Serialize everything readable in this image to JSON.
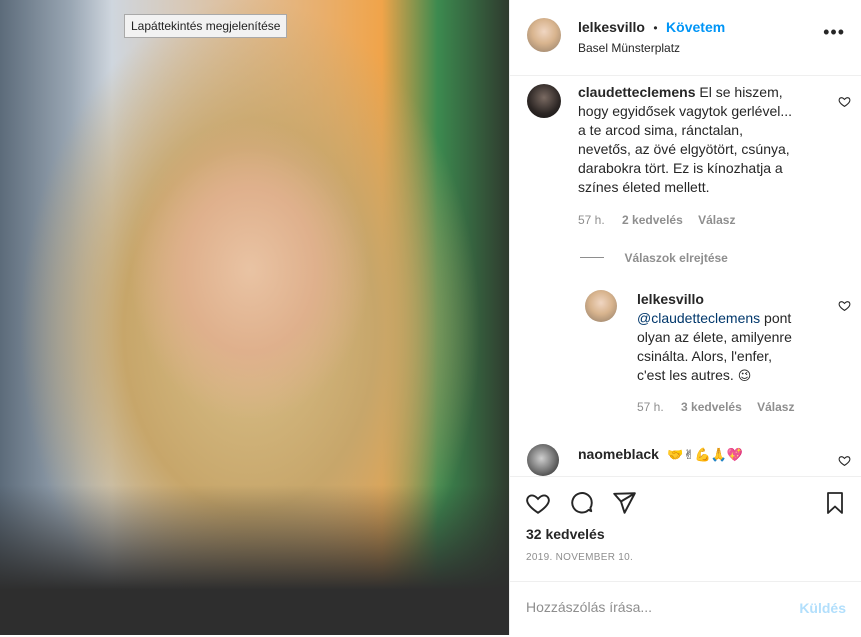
{
  "photo": {
    "tooltip": "Lapáttekintés megjelenítése"
  },
  "header": {
    "username": "lelkesvillo",
    "separator": "•",
    "follow_label": "Követem",
    "location": "Basel Münsterplatz",
    "more": "•••"
  },
  "comments": [
    {
      "username": "claudetteclemens",
      "lines": [
        "El se hiszem,",
        "hogy egyidősek vagytok gerlével...",
        "a te arcod sima, ránctalan,",
        "nevetős, az övé elgyötört, csúnya,",
        "darabokra tört. Ez is kínozhatja a",
        "színes életed mellett."
      ],
      "time": "57 h.",
      "likes": "2 kedvelés",
      "reply": "Válasz"
    }
  ],
  "hide_replies": "Válaszok elrejtése",
  "reply": {
    "username": "lelkesvillo",
    "mention": "@claudetteclemens",
    "line1_rest": " pont",
    "lines": [
      "olyan az élete, amilyenre",
      "csinálta. Alors, l'enfer,"
    ],
    "last_line": "c'est les autres. ",
    "last_emoji": "😉",
    "time": "57 h.",
    "likes": "3 kedvelés",
    "reply_label": "Válasz"
  },
  "partial_comment": {
    "username": "naomeblack",
    "emojis": "🤝✌💪🙏💖"
  },
  "actions": {
    "likes_count": "32 kedvelés",
    "date": "2019. NOVEMBER 10."
  },
  "comment_input": {
    "placeholder": "Hozzászólás írása...",
    "post_label": "Küldés"
  }
}
